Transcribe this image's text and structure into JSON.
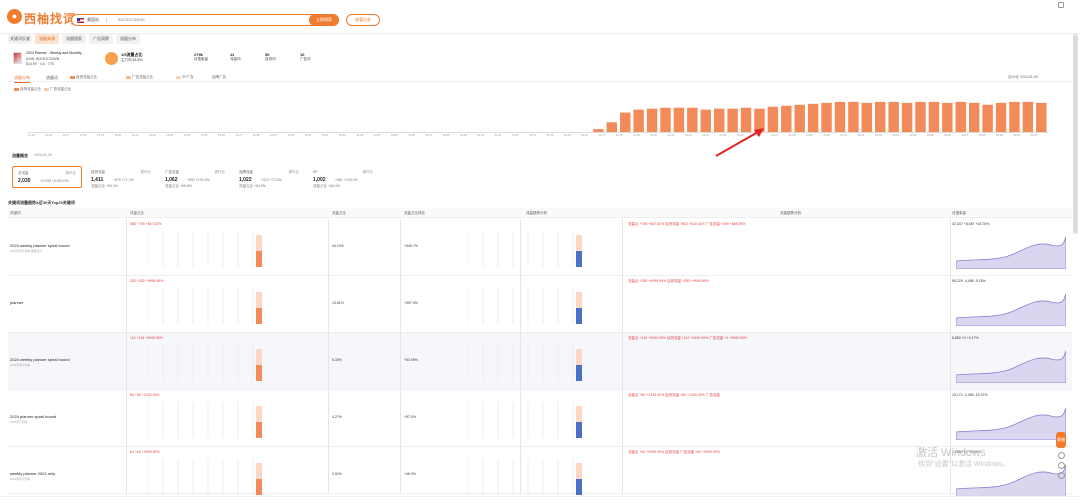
{
  "header": {
    "logo_text": "西柚找词",
    "market": "美国站",
    "keyword": "B0CR2C53MN",
    "search_btn": "立即搜索",
    "history_btn": "查看历史"
  },
  "tabs": [
    "关键词反查",
    "流量来源",
    "流量搜索",
    "广告洞察",
    "流量分布"
  ],
  "product": {
    "title": "2024 Planner - Weekly and Monthly...",
    "asin": "ASIN: B0CR2C53MN",
    "meta": "$14.99  ·  4.6  ·  778",
    "circle_label": "",
    "stats": [
      {
        "value": "1/5流量占比",
        "sub": "主力词 44.8%"
      },
      {
        "value": "279k",
        "sub": "月搜索量"
      },
      {
        "value": "11",
        "sub": "流量词"
      },
      {
        "value": "56",
        "sub": "自然词"
      },
      {
        "value": "16",
        "sub": "广告词"
      }
    ]
  },
  "subtabs": [
    "流量分布",
    "流量词",
    "流量趋势"
  ],
  "legends_top": [
    "自然流量占比",
    "广告流量占比",
    "SP广告",
    "品牌广告",
    "视频广告"
  ],
  "chart_legends": [
    "自然流量占比",
    "广告流量占比"
  ],
  "chart_date": "近30天 2024-01-09",
  "chart_data": {
    "type": "bar",
    "categories": [
      "12-15",
      "12-16",
      "12-17",
      "12-18",
      "12-19",
      "12-20",
      "12-21",
      "12-22",
      "12-23",
      "12-24",
      "12-25",
      "12-26",
      "12-27",
      "12-28",
      "12-29",
      "12-30",
      "12-31",
      "01-01",
      "01-02",
      "01-03",
      "01-04",
      "01-05",
      "01-06",
      "01-07",
      "01-08",
      "01-09",
      "01-10",
      "01-11",
      "01-12",
      "01-13",
      "01-14",
      "01-15",
      "01-16",
      "01-17",
      "01-18",
      "01-19",
      "01-20",
      "01-21",
      "01-22",
      "01-23",
      "01-24",
      "01-25",
      "01-26",
      "01-27",
      "01-28",
      "01-29",
      "01-30",
      "01-31",
      "02-01",
      "02-02",
      "02-03",
      "02-04",
      "02-05",
      "02-06",
      "02-07",
      "02-08",
      "02-09",
      "02-10",
      "02-11"
    ],
    "values": [
      0,
      0,
      0,
      0,
      0,
      0,
      0,
      0,
      0,
      0,
      0,
      0,
      0,
      0,
      0,
      0,
      0,
      0,
      0,
      0,
      0,
      0,
      0,
      0,
      0,
      0,
      0,
      0,
      0,
      0,
      0,
      0,
      0,
      0,
      0,
      0,
      0,
      0,
      0,
      0,
      0,
      0,
      3,
      10,
      20,
      23,
      24,
      25,
      25,
      25,
      23,
      24,
      24,
      25,
      24,
      26,
      27,
      28,
      29,
      30,
      31,
      31,
      30,
      31,
      31,
      30,
      31,
      31,
      30,
      31,
      30,
      28,
      30,
      31,
      31,
      30
    ],
    "ylim": [
      0,
      35
    ]
  },
  "summary": {
    "title": "流量概览",
    "date": "2024-01-09",
    "cards": [
      {
        "l": "总流量",
        "r": "周环比",
        "v": "2,035",
        "c": "+2,035 +6,000.0%",
        "c2": ""
      },
      {
        "l": "自然流量",
        "r": "周环比",
        "v": "1,411",
        "c": "+875 +71.3%",
        "c2": "流量占比 +69.3%"
      },
      {
        "l": "广告流量",
        "r": "周环比",
        "v": "1,062",
        "c": "+592 +100.3%",
        "c2": "流量占比 +66.8%"
      },
      {
        "l": "品牌流量",
        "r": "周环比",
        "v": "1,022",
        "c": "+512 +72.0%",
        "c2": "流量占比 +64.8%"
      },
      {
        "l": "SP",
        "r": "周环比",
        "v": "1,002",
        "c": "+681 +193.0%",
        "c2": "流量占比 +66.4%"
      }
    ]
  },
  "table_title": "关键词流量趋势&近30天Top20关键词",
  "headers": [
    "关键词",
    "流量占比",
    "流量占比",
    "流量占比排名",
    "流量趋势分析",
    "流量趋势分析",
    "月搜索量"
  ],
  "rows": [
    {
      "kw": "2024 weekly planner spiral bound",
      "sub": "2024年周计划本 螺旋装订",
      "traffic": "856  +795 +667.82%",
      "pct": "40.10%",
      "chg": "+345.7%",
      "rank": "流量点 +795 +667.82%   自然流量 +802 +610.41%   广告流量 +399 +888.95%",
      "vol": "42,347  +8,487 +18.76%"
    },
    {
      "kw": "planner",
      "sub": "",
      "traffic": "282  +282 +9999.99%",
      "pct": "13.61%",
      "chg": "+357.0%",
      "rank": "流量点 +282 +9999.99%   自然流量 +282 +9999.99%",
      "vol": "98,229  -4,498 -5.18%"
    },
    {
      "kw": "2024 weekly planner spiral bound",
      "sub": "2024年周计划本",
      "traffic": "116  +116 +9999.99%",
      "pct": "5.30%",
      "chg": "+53.99%",
      "rank": "流量点 +116 +9999.99%   自然流量 +112 +9999.99%   广告流量 +4 +9999.99%",
      "vol": "8,850  +0 +0.17%"
    },
    {
      "kw": "2024 planner spiral bound",
      "sub": "2024年计划本",
      "traffic": "86  +80 +1333.33%",
      "pct": "4.27%",
      "chg": "+57.0%",
      "rank": "流量点 +80 +1333.33%   自然流量 +80 +1333.33%   广告流量",
      "vol": "10,174  -2,456 -19.37%"
    },
    {
      "kw": "weekly planner 2024 only",
      "sub": "2024年周计划本",
      "traffic": "62  +62 +9999.99%",
      "pct": "2.91%",
      "chg": "+46.3%",
      "rank": "流量点 +62 +9999.99%   自然流量   广告流量 +62 +9999.99%",
      "vol": "1,288  +82 +5.48%"
    }
  ],
  "watermark": {
    "line1": "激活 Windows",
    "line2": "转到\"设置\"以激活 Windows。"
  },
  "sidebar_badge": "客服",
  "colors": {
    "accent": "#f07c2e",
    "bar": "#f28a5a",
    "blue": "#4a6fc7"
  }
}
